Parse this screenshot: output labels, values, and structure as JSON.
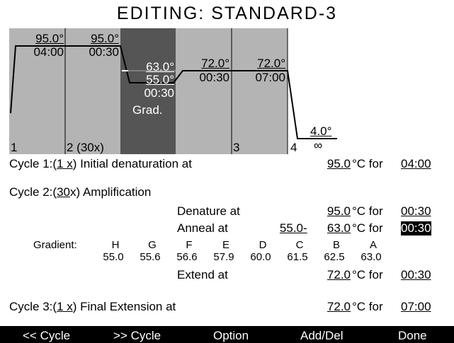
{
  "title": "EDITING: STANDARD-3",
  "profile": {
    "seg1": {
      "temp": "95.0°",
      "time": "04:00",
      "step": "1"
    },
    "seg2": {
      "temp": "95.0°",
      "time": "00:30",
      "step": "2 (30x)"
    },
    "seg3": {
      "temp_high": "63.0°",
      "temp_low": "55.0°",
      "time": "00:30",
      "label": "Grad."
    },
    "seg4": {
      "temp": "72.0°",
      "time": "00:30"
    },
    "seg5": {
      "temp": "72.0°",
      "time": "07:00",
      "step": "3"
    },
    "seg6": {
      "temp": "4.0°",
      "time": "∞",
      "step": "4"
    }
  },
  "cycle1": {
    "prefix": "Cycle 1:(",
    "count": "1 x",
    "desc": ") Initial denaturation at",
    "temp": "95.0",
    "for": "°C for",
    "time": "04:00"
  },
  "cycle2": {
    "prefix": "Cycle 2:(",
    "count": "30",
    "desc": "x) Amplification",
    "denature": {
      "label": "Denature at",
      "temp": "95.0",
      "for": "°C for",
      "time": "00:30"
    },
    "anneal": {
      "label": "Anneal at",
      "temp_low": "55.0",
      "dash": " - ",
      "temp_high": "63.0",
      "for": "°C for",
      "time": "00:30"
    },
    "gradient": {
      "label": "Gradient:",
      "letters": [
        "H",
        "G",
        "F",
        "E",
        "D",
        "C",
        "B",
        "A"
      ],
      "values": [
        "55.0",
        "55.6",
        "56.6",
        "57.9",
        "60.0",
        "61.5",
        "62.5",
        "63.0"
      ]
    },
    "extend": {
      "label": "Extend at",
      "temp": "72.0",
      "for": "°C for",
      "time": "00:30"
    }
  },
  "cycle3": {
    "prefix": "Cycle 3:(",
    "count": "1 x",
    "desc": ") Final Extension at",
    "temp": "72.0",
    "for": "°C for",
    "time": "07:00"
  },
  "menu": {
    "prev_cycle": "<< Cycle",
    "next_cycle": ">> Cycle",
    "option": "Option",
    "add_del": "Add/Del",
    "done": "Done"
  },
  "colors": {
    "segment_gray": "#b4b4b4",
    "segment_dark": "#555555",
    "background": "#ffffff",
    "menu_bar": "#000000"
  }
}
